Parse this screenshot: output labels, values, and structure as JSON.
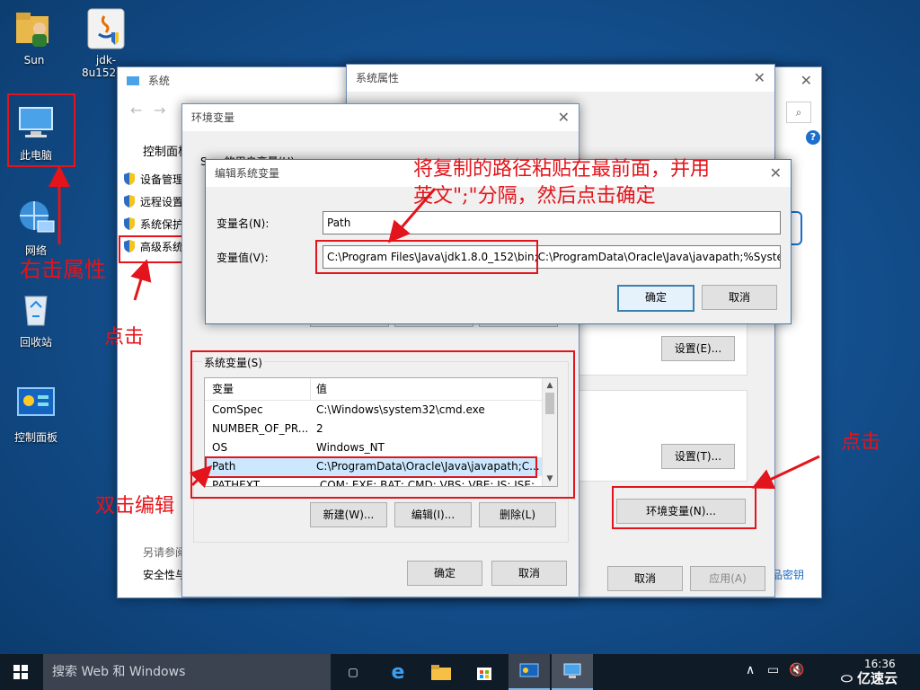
{
  "desktop": {
    "icons": [
      {
        "label": "Sun"
      },
      {
        "label": "jdk-8u152-..."
      },
      {
        "label": "此电脑"
      },
      {
        "label": "网络"
      },
      {
        "label": "回收站"
      },
      {
        "label": "控制面板"
      }
    ]
  },
  "system_window": {
    "title": "系统",
    "breadcrumb": "控制面板",
    "nav_items": [
      "设备管理",
      "远程设置",
      "系统保护",
      "高级系统"
    ],
    "see_also": "另请参阅",
    "security_link": "安全性与",
    "right_link": "品密钥"
  },
  "system_properties": {
    "title": "系统属性",
    "settings_e": "设置(E)...",
    "settings_t": "设置(T)...",
    "env_vars_button": "环境变量(N)...",
    "cancel": "取消",
    "apply": "应用(A)"
  },
  "env_dialog": {
    "title": "环境变量",
    "user_vars_label": "Sun 的用户变量(U)",
    "system_vars_label": "系统变量(S)",
    "columns": [
      "变量",
      "值"
    ],
    "rows": [
      {
        "name": "ComSpec",
        "value": "C:\\Windows\\system32\\cmd.exe"
      },
      {
        "name": "NUMBER_OF_PR...",
        "value": "2"
      },
      {
        "name": "OS",
        "value": "Windows_NT"
      },
      {
        "name": "Path",
        "value": "C:\\ProgramData\\Oracle\\Java\\javapath;C..."
      },
      {
        "name": "PATHEXT",
        "value": ".COM;.EXE;.BAT;.CMD;.VBS;.VBE;.JS;.JSE;..."
      }
    ],
    "new_button": "新建(W)...",
    "edit_button": "编辑(I)...",
    "delete_button": "删除(L)",
    "ok": "确定",
    "cancel": "取消"
  },
  "edit_dialog": {
    "title": "编辑系统变量",
    "name_label": "变量名(N):",
    "name_value": "Path",
    "value_label": "变量值(V):",
    "value_value": "C:\\Program Files\\Java\\jdk1.8.0_152\\bin;C:\\ProgramData\\Oracle\\Java\\javapath;%SystemRoot%",
    "ok": "确定",
    "cancel": "取消"
  },
  "annotations": {
    "right_click": "右击属性",
    "click_left": "点击",
    "double_click": "双击编辑",
    "click_right": "点击",
    "instruction_line1": "将复制的路径粘贴在最前面，并用",
    "instruction_line2": "英文\";\"分隔，然后点击确定"
  },
  "taskbar": {
    "search_placeholder": "搜索 Web 和 Windows",
    "time": "16:36",
    "watermark": "亿速云"
  },
  "colors": {
    "annotation_red": "#e3141b",
    "taskbar": "#101b28",
    "accent": "#3c7fb1"
  }
}
